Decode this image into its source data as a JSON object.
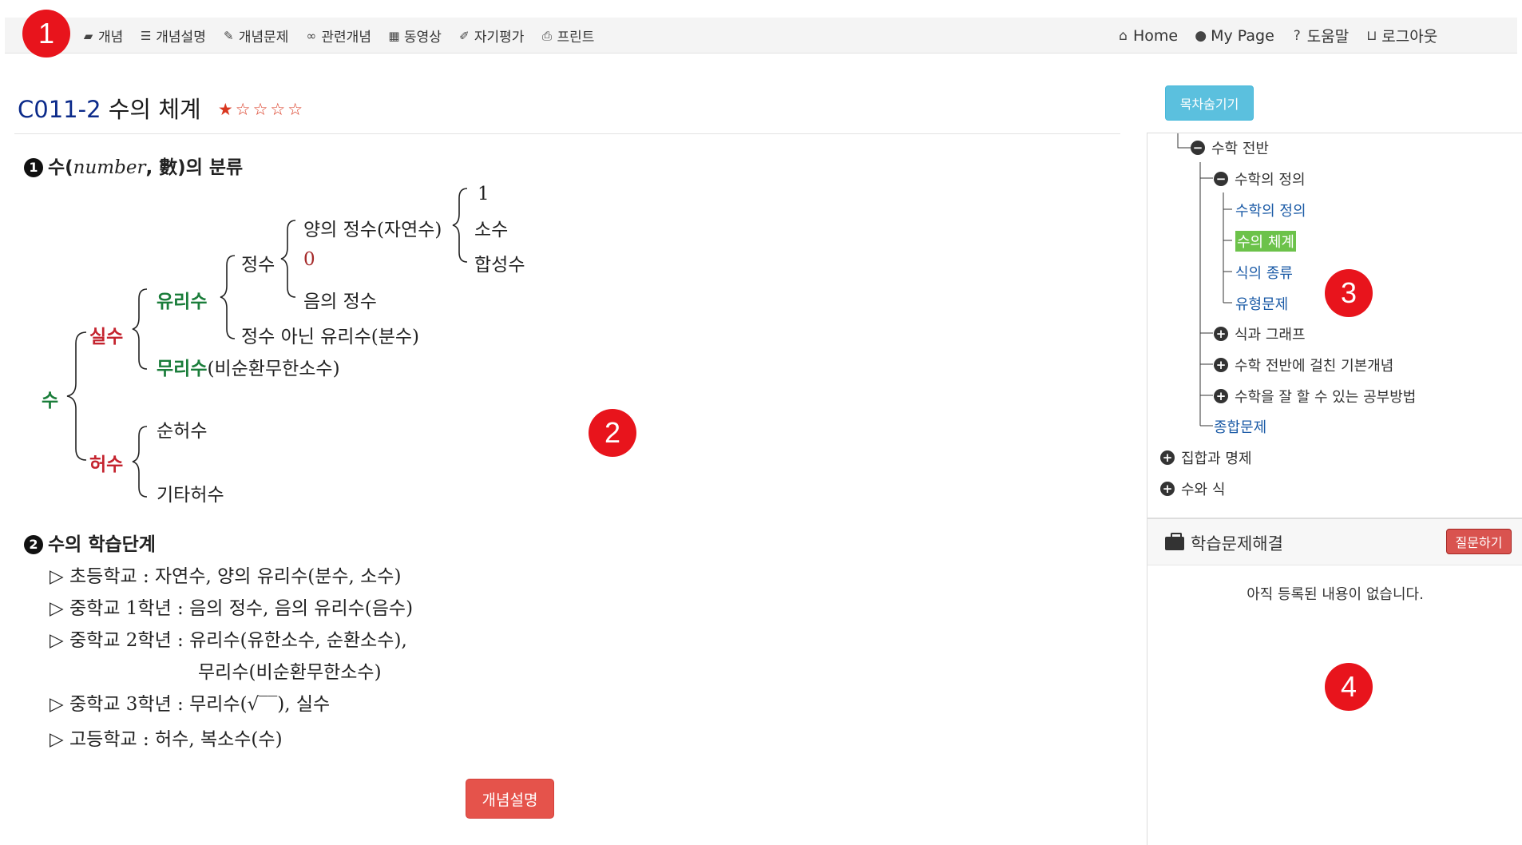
{
  "nav": {
    "left": [
      {
        "icon": "book-icon",
        "glyph": "▰",
        "label": "개념"
      },
      {
        "icon": "list-icon",
        "glyph": "☰",
        "label": "개념설명"
      },
      {
        "icon": "pencil-icon",
        "glyph": "✎",
        "label": "개념문제"
      },
      {
        "icon": "link-icon",
        "glyph": "∞",
        "label": "관련개념"
      },
      {
        "icon": "film-icon",
        "glyph": "▦",
        "label": "동영상"
      },
      {
        "icon": "edit-icon",
        "glyph": "✐",
        "label": "자기평가"
      },
      {
        "icon": "print-icon",
        "glyph": "⎙",
        "label": "프린트"
      }
    ],
    "right": [
      {
        "icon": "home-icon",
        "glyph": "⌂",
        "label": "Home"
      },
      {
        "icon": "user-icon",
        "glyph": "●",
        "label": "My Page"
      },
      {
        "icon": "question-icon",
        "glyph": "?",
        "label": "도움말"
      },
      {
        "icon": "unlock-icon",
        "glyph": "⊔",
        "label": "로그아웃"
      }
    ]
  },
  "markers": {
    "m1": "1",
    "m2": "2",
    "m3": "3",
    "m4": "4"
  },
  "page": {
    "code": "C011-2",
    "title": "수의 체계",
    "stars": "★☆☆☆☆"
  },
  "concept": {
    "sec1": {
      "num": "1",
      "pre": "수(",
      "italic": "number",
      "post": ", 數)의 분류"
    },
    "tree": {
      "su": "수",
      "silsu": "실수",
      "heosu": "허수",
      "yurisu": "유리수",
      "murisu": "무리수",
      "murisu_note": "(비순환무한소수)",
      "jeongsu": "정수",
      "not_integer": "정수 아닌 유리수(분수)",
      "positive": "양의 정수(자연수)",
      "zero": "0",
      "negative": "음의 정수",
      "one": "1",
      "prime": "소수",
      "composite": "합성수",
      "pure_imag": "순허수",
      "other_imag": "기타허수"
    },
    "sec2": {
      "num": "2",
      "title": "수의 학습단계"
    },
    "stages": [
      "▷ 초등학교 : 자연수, 양의 유리수(분수, 소수)",
      "▷ 중학교 1학년 : 음의 정수, 음의 유리수(음수)",
      "▷ 중학교 2학년 : 유리수(유한소수, 순환소수),",
      "무리수(비순환무한소수)",
      "▷ 중학교 3학년 : 무리수(√‾‾), 실수",
      "▷ 고등학교      :  허수, 복소수(수)"
    ]
  },
  "buttons": {
    "concept_explain": "개념설명",
    "toc_toggle": "목차숨기기",
    "ask": "질문하기"
  },
  "toc": {
    "items": [
      {
        "label": "수학 전반",
        "bullet": "−",
        "type": "folder"
      },
      {
        "label": "수학의 정의",
        "bullet": "−",
        "type": "folder"
      },
      {
        "label": "수학의 정의",
        "type": "link"
      },
      {
        "label": "수의 체계",
        "type": "active"
      },
      {
        "label": "식의 종류",
        "type": "link"
      },
      {
        "label": "유형문제",
        "type": "link"
      },
      {
        "label": "식과 그래프",
        "bullet": "+",
        "type": "folder"
      },
      {
        "label": "수학 전반에 걸친 기본개념",
        "bullet": "+",
        "type": "folder"
      },
      {
        "label": "수학을 잘 할 수 있는 공부방법",
        "bullet": "+",
        "type": "folder"
      },
      {
        "label": "종합문제",
        "type": "link"
      },
      {
        "label": "집합과 명제",
        "bullet": "+",
        "type": "folder"
      },
      {
        "label": "수와 식",
        "bullet": "+",
        "type": "folder"
      }
    ]
  },
  "qa": {
    "title": "학습문제해결",
    "empty": "아직 등록된 내용이 없습니다."
  },
  "colors": {
    "marker": "#e8141c",
    "green": "#1a7d3a",
    "red": "#c4232e",
    "toc_active": "#6cc24a",
    "link": "#1a5aa6",
    "btn_red": "#e5534b",
    "btn_info": "#5bc0de"
  }
}
